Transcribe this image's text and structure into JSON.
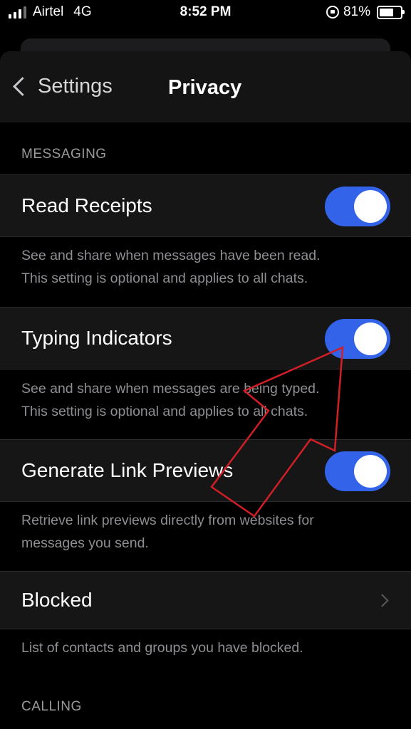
{
  "status_bar": {
    "carrier": "Airtel",
    "network": "4G",
    "time": "8:52 PM",
    "battery": "81%",
    "battery_level": 0.81,
    "signal_bars_active": 3,
    "signal_bars_total": 4
  },
  "nav": {
    "back_label": "Settings",
    "title": "Privacy"
  },
  "sections": {
    "messaging": {
      "header": "MESSAGING",
      "read_receipts": {
        "label": "Read Receipts",
        "enabled": true,
        "footer_line1": "See and share when messages have been read.",
        "footer_line2": "This setting is optional and applies to all chats."
      },
      "typing_indicators": {
        "label": "Typing Indicators",
        "enabled": true,
        "footer_line1": "See and share when messages are being typed.",
        "footer_line2": "This setting is optional and applies to all chats."
      },
      "link_previews": {
        "label": "Generate Link Previews",
        "enabled": true,
        "footer_line1": "Retrieve link previews directly from websites for",
        "footer_line2": "messages you send."
      },
      "blocked": {
        "label": "Blocked",
        "footer": "List of contacts and groups you have blocked."
      }
    },
    "calling": {
      "header": "CALLING"
    }
  },
  "colors": {
    "toggle_on": "#3263e8",
    "annotation_arrow": "#d21f26"
  },
  "icons": {
    "back": "chevron-left-icon",
    "blocked_row": "chevron-right-icon",
    "orientation_lock": "orientation-lock-icon"
  }
}
